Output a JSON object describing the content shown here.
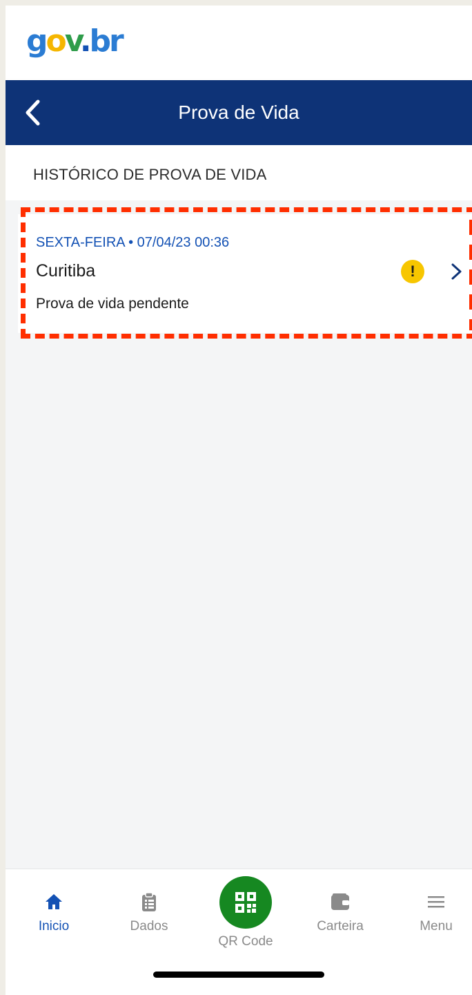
{
  "brand": {
    "logo_text": "gov.br",
    "colors": {
      "blue": "#2b7cd3",
      "yellow": "#f5b600",
      "green": "#2e9c4a",
      "navy": "#0e3377"
    }
  },
  "header": {
    "title": "Prova de Vida",
    "back_icon": "chevron-left-icon"
  },
  "section": {
    "title": "HISTÓRICO DE PROVA DE VIDA"
  },
  "history": [
    {
      "date": "SEXTA-FEIRA • 07/04/23 00:36",
      "city": "Curitiba",
      "status": "Prova de vida pendente",
      "status_icon": "warning-icon",
      "status_color": "#f7c600"
    }
  ],
  "bottom_nav": {
    "items": [
      {
        "label": "Inicio",
        "icon": "home-icon",
        "active": true
      },
      {
        "label": "Dados",
        "icon": "clipboard-icon",
        "active": false
      },
      {
        "label": "QR Code",
        "icon": "qr-code-icon",
        "active": false
      },
      {
        "label": "Carteira",
        "icon": "wallet-icon",
        "active": false
      },
      {
        "label": "Menu",
        "icon": "hamburger-menu-icon",
        "active": false
      }
    ],
    "active_color": "#1351b4",
    "qr_color": "#168821"
  }
}
